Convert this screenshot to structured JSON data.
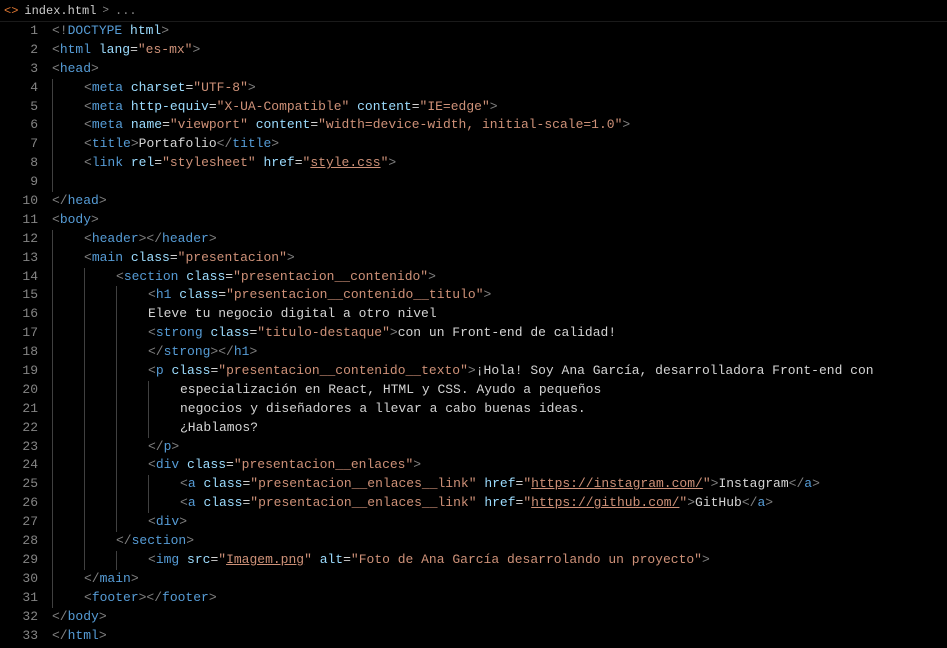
{
  "tabs": {
    "icon": "<>",
    "filename": "index.html",
    "separator": ">",
    "trail": "..."
  },
  "lines": [
    {
      "n": "1",
      "indent": 0,
      "guides": [],
      "tokens": [
        {
          "c": "bracket",
          "t": "<!"
        },
        {
          "c": "doctype",
          "t": "DOCTYPE"
        },
        {
          "c": "text",
          "t": " "
        },
        {
          "c": "attr",
          "t": "html"
        },
        {
          "c": "bracket",
          "t": ">"
        }
      ]
    },
    {
      "n": "2",
      "indent": 0,
      "guides": [],
      "tokens": [
        {
          "c": "bracket",
          "t": "<"
        },
        {
          "c": "tag",
          "t": "html"
        },
        {
          "c": "text",
          "t": " "
        },
        {
          "c": "attr",
          "t": "lang"
        },
        {
          "c": "text",
          "t": "="
        },
        {
          "c": "string",
          "t": "\"es-mx\""
        },
        {
          "c": "bracket",
          "t": ">"
        }
      ]
    },
    {
      "n": "3",
      "indent": 0,
      "guides": [],
      "tokens": [
        {
          "c": "bracket",
          "t": "<"
        },
        {
          "c": "tag",
          "t": "head"
        },
        {
          "c": "bracket",
          "t": ">"
        }
      ]
    },
    {
      "n": "4",
      "indent": 1,
      "guides": [
        0
      ],
      "tokens": [
        {
          "c": "bracket",
          "t": "<"
        },
        {
          "c": "tag",
          "t": "meta"
        },
        {
          "c": "text",
          "t": " "
        },
        {
          "c": "attr",
          "t": "charset"
        },
        {
          "c": "text",
          "t": "="
        },
        {
          "c": "string",
          "t": "\"UTF-8\""
        },
        {
          "c": "bracket",
          "t": ">"
        }
      ]
    },
    {
      "n": "5",
      "indent": 1,
      "guides": [
        0
      ],
      "tokens": [
        {
          "c": "bracket",
          "t": "<"
        },
        {
          "c": "tag",
          "t": "meta"
        },
        {
          "c": "text",
          "t": " "
        },
        {
          "c": "attr",
          "t": "http-equiv"
        },
        {
          "c": "text",
          "t": "="
        },
        {
          "c": "string",
          "t": "\"X-UA-Compatible\""
        },
        {
          "c": "text",
          "t": " "
        },
        {
          "c": "attr",
          "t": "content"
        },
        {
          "c": "text",
          "t": "="
        },
        {
          "c": "string",
          "t": "\"IE=edge\""
        },
        {
          "c": "bracket",
          "t": ">"
        }
      ]
    },
    {
      "n": "6",
      "indent": 1,
      "guides": [
        0
      ],
      "tokens": [
        {
          "c": "bracket",
          "t": "<"
        },
        {
          "c": "tag",
          "t": "meta"
        },
        {
          "c": "text",
          "t": " "
        },
        {
          "c": "attr",
          "t": "name"
        },
        {
          "c": "text",
          "t": "="
        },
        {
          "c": "string",
          "t": "\"viewport\""
        },
        {
          "c": "text",
          "t": " "
        },
        {
          "c": "attr",
          "t": "content"
        },
        {
          "c": "text",
          "t": "="
        },
        {
          "c": "string",
          "t": "\"width=device-width, initial-scale=1.0\""
        },
        {
          "c": "bracket",
          "t": ">"
        }
      ]
    },
    {
      "n": "7",
      "indent": 1,
      "guides": [
        0
      ],
      "tokens": [
        {
          "c": "bracket",
          "t": "<"
        },
        {
          "c": "tag",
          "t": "title"
        },
        {
          "c": "bracket",
          "t": ">"
        },
        {
          "c": "text",
          "t": "Portafolio"
        },
        {
          "c": "bracket",
          "t": "</"
        },
        {
          "c": "tag",
          "t": "title"
        },
        {
          "c": "bracket",
          "t": ">"
        }
      ]
    },
    {
      "n": "8",
      "indent": 1,
      "guides": [
        0
      ],
      "tokens": [
        {
          "c": "bracket",
          "t": "<"
        },
        {
          "c": "tag",
          "t": "link"
        },
        {
          "c": "text",
          "t": " "
        },
        {
          "c": "attr",
          "t": "rel"
        },
        {
          "c": "text",
          "t": "="
        },
        {
          "c": "string",
          "t": "\"stylesheet\""
        },
        {
          "c": "text",
          "t": " "
        },
        {
          "c": "attr",
          "t": "href"
        },
        {
          "c": "text",
          "t": "="
        },
        {
          "c": "string",
          "t": "\""
        },
        {
          "c": "string underline",
          "t": "style.css"
        },
        {
          "c": "string",
          "t": "\""
        },
        {
          "c": "bracket",
          "t": ">"
        }
      ]
    },
    {
      "n": "9",
      "indent": 0,
      "guides": [
        0
      ],
      "tokens": []
    },
    {
      "n": "10",
      "indent": 0,
      "guides": [],
      "tokens": [
        {
          "c": "bracket",
          "t": "</"
        },
        {
          "c": "tag",
          "t": "head"
        },
        {
          "c": "bracket",
          "t": ">"
        }
      ]
    },
    {
      "n": "11",
      "indent": 0,
      "guides": [],
      "tokens": [
        {
          "c": "bracket",
          "t": "<"
        },
        {
          "c": "tag",
          "t": "body"
        },
        {
          "c": "bracket",
          "t": ">"
        }
      ]
    },
    {
      "n": "12",
      "indent": 1,
      "guides": [
        0
      ],
      "tokens": [
        {
          "c": "bracket",
          "t": "<"
        },
        {
          "c": "tag",
          "t": "header"
        },
        {
          "c": "bracket",
          "t": "></"
        },
        {
          "c": "tag",
          "t": "header"
        },
        {
          "c": "bracket",
          "t": ">"
        }
      ]
    },
    {
      "n": "13",
      "indent": 1,
      "guides": [
        0
      ],
      "tokens": [
        {
          "c": "bracket",
          "t": "<"
        },
        {
          "c": "tag",
          "t": "main"
        },
        {
          "c": "text",
          "t": " "
        },
        {
          "c": "attr",
          "t": "class"
        },
        {
          "c": "text",
          "t": "="
        },
        {
          "c": "string",
          "t": "\"presentacion\""
        },
        {
          "c": "bracket",
          "t": ">"
        }
      ]
    },
    {
      "n": "14",
      "indent": 2,
      "guides": [
        0,
        1
      ],
      "tokens": [
        {
          "c": "bracket",
          "t": "<"
        },
        {
          "c": "tag",
          "t": "section"
        },
        {
          "c": "text",
          "t": " "
        },
        {
          "c": "attr",
          "t": "class"
        },
        {
          "c": "text",
          "t": "="
        },
        {
          "c": "string",
          "t": "\"presentacion__contenido\""
        },
        {
          "c": "bracket",
          "t": ">"
        }
      ]
    },
    {
      "n": "15",
      "indent": 3,
      "guides": [
        0,
        1,
        2
      ],
      "tokens": [
        {
          "c": "bracket",
          "t": "<"
        },
        {
          "c": "tag",
          "t": "h1"
        },
        {
          "c": "text",
          "t": " "
        },
        {
          "c": "attr",
          "t": "class"
        },
        {
          "c": "text",
          "t": "="
        },
        {
          "c": "string",
          "t": "\"presentacion__contenido__titulo\""
        },
        {
          "c": "bracket",
          "t": ">"
        }
      ]
    },
    {
      "n": "16",
      "indent": 3,
      "guides": [
        0,
        1,
        2
      ],
      "tokens": [
        {
          "c": "text",
          "t": "Eleve tu negocio digital a otro nivel"
        }
      ]
    },
    {
      "n": "17",
      "indent": 3,
      "guides": [
        0,
        1,
        2
      ],
      "tokens": [
        {
          "c": "bracket",
          "t": "<"
        },
        {
          "c": "tag",
          "t": "strong"
        },
        {
          "c": "text",
          "t": " "
        },
        {
          "c": "attr",
          "t": "class"
        },
        {
          "c": "text",
          "t": "="
        },
        {
          "c": "string",
          "t": "\"titulo-destaque\""
        },
        {
          "c": "bracket",
          "t": ">"
        },
        {
          "c": "text",
          "t": "con un Front-end de calidad!"
        }
      ]
    },
    {
      "n": "18",
      "indent": 3,
      "guides": [
        0,
        1,
        2
      ],
      "tokens": [
        {
          "c": "bracket",
          "t": "</"
        },
        {
          "c": "tag",
          "t": "strong"
        },
        {
          "c": "bracket",
          "t": "></"
        },
        {
          "c": "tag",
          "t": "h1"
        },
        {
          "c": "bracket",
          "t": ">"
        }
      ]
    },
    {
      "n": "19",
      "indent": 3,
      "guides": [
        0,
        1,
        2
      ],
      "tokens": [
        {
          "c": "bracket",
          "t": "<"
        },
        {
          "c": "tag",
          "t": "p"
        },
        {
          "c": "text",
          "t": " "
        },
        {
          "c": "attr",
          "t": "class"
        },
        {
          "c": "text",
          "t": "="
        },
        {
          "c": "string",
          "t": "\"presentacion__contenido__texto\""
        },
        {
          "c": "bracket",
          "t": ">"
        },
        {
          "c": "text",
          "t": "¡Hola! Soy Ana García, desarrolladora Front-end con"
        }
      ]
    },
    {
      "n": "20",
      "indent": 4,
      "guides": [
        0,
        1,
        2,
        3
      ],
      "tokens": [
        {
          "c": "text",
          "t": "especialización en React, HTML y CSS. Ayudo a pequeños"
        }
      ]
    },
    {
      "n": "21",
      "indent": 4,
      "guides": [
        0,
        1,
        2,
        3
      ],
      "tokens": [
        {
          "c": "text",
          "t": "negocios y diseñadores a llevar a cabo buenas ideas."
        }
      ]
    },
    {
      "n": "22",
      "indent": 4,
      "guides": [
        0,
        1,
        2,
        3
      ],
      "tokens": [
        {
          "c": "text",
          "t": "¿Hablamos?"
        }
      ]
    },
    {
      "n": "23",
      "indent": 3,
      "guides": [
        0,
        1,
        2
      ],
      "tokens": [
        {
          "c": "bracket",
          "t": "</"
        },
        {
          "c": "tag",
          "t": "p"
        },
        {
          "c": "bracket",
          "t": ">"
        }
      ]
    },
    {
      "n": "24",
      "indent": 3,
      "guides": [
        0,
        1,
        2
      ],
      "tokens": [
        {
          "c": "bracket",
          "t": "<"
        },
        {
          "c": "tag",
          "t": "div"
        },
        {
          "c": "text",
          "t": " "
        },
        {
          "c": "attr",
          "t": "class"
        },
        {
          "c": "text",
          "t": "="
        },
        {
          "c": "string",
          "t": "\"presentacion__enlaces\""
        },
        {
          "c": "bracket",
          "t": ">"
        }
      ]
    },
    {
      "n": "25",
      "indent": 4,
      "guides": [
        0,
        1,
        2,
        3
      ],
      "tokens": [
        {
          "c": "bracket",
          "t": "<"
        },
        {
          "c": "tag",
          "t": "a"
        },
        {
          "c": "text",
          "t": " "
        },
        {
          "c": "attr",
          "t": "class"
        },
        {
          "c": "text",
          "t": "="
        },
        {
          "c": "string",
          "t": "\"presentacion__enlaces__link\""
        },
        {
          "c": "text",
          "t": " "
        },
        {
          "c": "attr",
          "t": "href"
        },
        {
          "c": "text",
          "t": "="
        },
        {
          "c": "string",
          "t": "\""
        },
        {
          "c": "string underline",
          "t": "https://instagram.com/"
        },
        {
          "c": "string",
          "t": "\""
        },
        {
          "c": "bracket",
          "t": ">"
        },
        {
          "c": "text",
          "t": "Instagram"
        },
        {
          "c": "bracket",
          "t": "</"
        },
        {
          "c": "tag",
          "t": "a"
        },
        {
          "c": "bracket",
          "t": ">"
        }
      ]
    },
    {
      "n": "26",
      "indent": 4,
      "guides": [
        0,
        1,
        2,
        3
      ],
      "tokens": [
        {
          "c": "bracket",
          "t": "<"
        },
        {
          "c": "tag",
          "t": "a"
        },
        {
          "c": "text",
          "t": " "
        },
        {
          "c": "attr",
          "t": "class"
        },
        {
          "c": "text",
          "t": "="
        },
        {
          "c": "string",
          "t": "\"presentacion__enlaces__link\""
        },
        {
          "c": "text",
          "t": " "
        },
        {
          "c": "attr",
          "t": "href"
        },
        {
          "c": "text",
          "t": "="
        },
        {
          "c": "string",
          "t": "\""
        },
        {
          "c": "string underline",
          "t": "https://github.com/"
        },
        {
          "c": "string",
          "t": "\""
        },
        {
          "c": "bracket",
          "t": ">"
        },
        {
          "c": "text",
          "t": "GitHub"
        },
        {
          "c": "bracket",
          "t": "</"
        },
        {
          "c": "tag",
          "t": "a"
        },
        {
          "c": "bracket",
          "t": ">"
        }
      ]
    },
    {
      "n": "27",
      "indent": 3,
      "guides": [
        0,
        1,
        2
      ],
      "tokens": [
        {
          "c": "bracket",
          "t": "<"
        },
        {
          "c": "tag",
          "t": "div"
        },
        {
          "c": "bracket",
          "t": ">"
        }
      ]
    },
    {
      "n": "28",
      "indent": 2,
      "guides": [
        0,
        1
      ],
      "tokens": [
        {
          "c": "bracket",
          "t": "</"
        },
        {
          "c": "tag",
          "t": "section"
        },
        {
          "c": "bracket",
          "t": ">"
        }
      ]
    },
    {
      "n": "29",
      "indent": 3,
      "guides": [
        0,
        1,
        2
      ],
      "tokens": [
        {
          "c": "bracket",
          "t": "<"
        },
        {
          "c": "tag",
          "t": "img"
        },
        {
          "c": "text",
          "t": " "
        },
        {
          "c": "attr",
          "t": "src"
        },
        {
          "c": "text",
          "t": "="
        },
        {
          "c": "string",
          "t": "\""
        },
        {
          "c": "string underline",
          "t": "Imagem.png"
        },
        {
          "c": "string",
          "t": "\""
        },
        {
          "c": "text",
          "t": " "
        },
        {
          "c": "attr",
          "t": "alt"
        },
        {
          "c": "text",
          "t": "="
        },
        {
          "c": "string",
          "t": "\"Foto de Ana García desarrolando un proyecto\""
        },
        {
          "c": "bracket",
          "t": ">"
        }
      ]
    },
    {
      "n": "30",
      "indent": 1,
      "guides": [
        0
      ],
      "tokens": [
        {
          "c": "bracket",
          "t": "</"
        },
        {
          "c": "tag",
          "t": "main"
        },
        {
          "c": "bracket",
          "t": ">"
        }
      ]
    },
    {
      "n": "31",
      "indent": 1,
      "guides": [
        0
      ],
      "tokens": [
        {
          "c": "bracket",
          "t": "<"
        },
        {
          "c": "tag",
          "t": "footer"
        },
        {
          "c": "bracket",
          "t": "></"
        },
        {
          "c": "tag",
          "t": "footer"
        },
        {
          "c": "bracket",
          "t": ">"
        }
      ]
    },
    {
      "n": "32",
      "indent": 0,
      "guides": [],
      "tokens": [
        {
          "c": "bracket",
          "t": "</"
        },
        {
          "c": "tag",
          "t": "body"
        },
        {
          "c": "bracket",
          "t": ">"
        }
      ]
    },
    {
      "n": "33",
      "indent": 0,
      "guides": [],
      "tokens": [
        {
          "c": "bracket",
          "t": "</"
        },
        {
          "c": "tag",
          "t": "html"
        },
        {
          "c": "bracket",
          "t": ">"
        }
      ]
    }
  ]
}
